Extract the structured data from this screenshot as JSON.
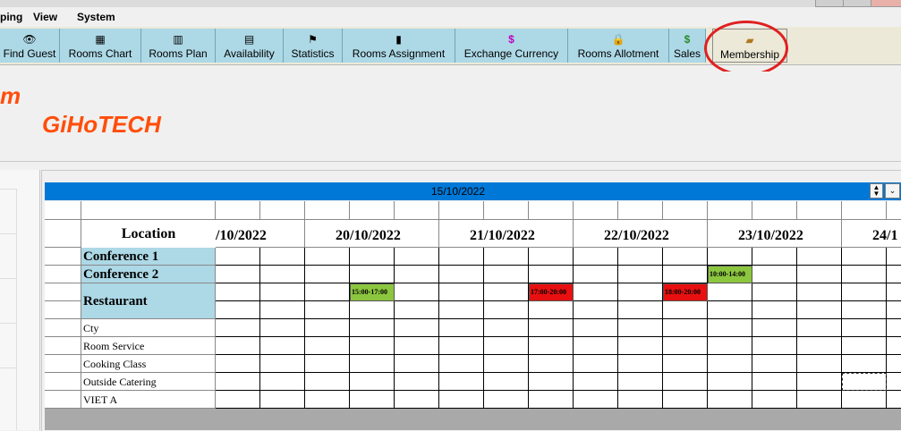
{
  "menu": [
    "ping",
    "View",
    "System"
  ],
  "toolbar": [
    {
      "label": "Find Guest",
      "icon": "binoculars-icon",
      "glyph": "👁"
    },
    {
      "label": "Rooms Chart",
      "icon": "rooms-chart-icon",
      "glyph": "▦"
    },
    {
      "label": "Rooms Plan",
      "icon": "rooms-plan-icon",
      "glyph": "▥"
    },
    {
      "label": "Availability",
      "icon": "availability-icon",
      "glyph": "▤"
    },
    {
      "label": "Statistics",
      "icon": "statistics-icon",
      "glyph": "⚑"
    },
    {
      "label": "Rooms Assignment",
      "icon": "rooms-assignment-icon",
      "glyph": "▮"
    },
    {
      "label": "Exchange Currency",
      "icon": "currency-icon",
      "glyph": "$"
    },
    {
      "label": "Rooms Allotment",
      "icon": "lock-icon",
      "glyph": "🔒"
    },
    {
      "label": "Sales",
      "icon": "dollar-icon",
      "glyph": "$"
    },
    {
      "label": "Membership",
      "icon": "membership-card-icon",
      "glyph": "▰"
    }
  ],
  "brand": {
    "line1": "m",
    "line2": "GiHoTECH"
  },
  "calendar": {
    "current_date": "15/10/2022",
    "location_header": "Location",
    "dates": [
      "/10/2022",
      "20/10/2022",
      "21/10/2022",
      "22/10/2022",
      "23/10/2022",
      "24/1"
    ],
    "locations": [
      {
        "name": "Conference 1",
        "style": "big"
      },
      {
        "name": "Conference 2",
        "style": "big"
      },
      {
        "name": "Restaurant",
        "style": "big"
      },
      {
        "name": "Cty",
        "style": "small"
      },
      {
        "name": "Room Service",
        "style": "small"
      },
      {
        "name": "Cooking Class",
        "style": "small"
      },
      {
        "name": "Outside Catering",
        "style": "small"
      },
      {
        "name": "VIET A",
        "style": "small"
      }
    ],
    "bookings": [
      {
        "time": "10:00-14:00",
        "color": "#8cc63f"
      },
      {
        "time": "15:00-17:00",
        "color": "#8cc63f"
      },
      {
        "time": "17:00-20:00",
        "color": "#e81010"
      },
      {
        "time": "18:00-20:00",
        "color": "#e81010"
      }
    ]
  },
  "colors": {
    "accent_blue": "#0078d7",
    "location_bg": "#add8e6",
    "brand_orange": "#ff4e0a",
    "highlight_red": "#e02020"
  }
}
